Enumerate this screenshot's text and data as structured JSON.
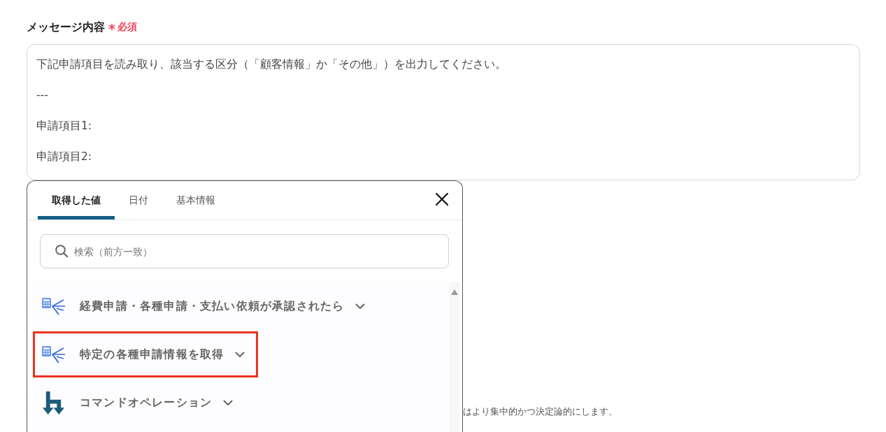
{
  "field": {
    "label": "メッセージ内容",
    "required_mark": "*",
    "required_label": "必須"
  },
  "message": {
    "lines": [
      "下記申請項目を読み取り、該当する区分（「顧客情報」か「その他」）を出力してください。",
      "---",
      "申請項目1:",
      "申請項目2:"
    ]
  },
  "help_text": "はより集中的かつ決定論的にします。",
  "picker": {
    "tabs": [
      {
        "label": "取得した値",
        "selected": true
      },
      {
        "label": "日付",
        "selected": false
      },
      {
        "label": "基本情報",
        "selected": false
      }
    ],
    "search": {
      "placeholder": "検索（前方一致）"
    },
    "items": [
      {
        "kind": "app",
        "label": "経費申請・各種申請・支払い依頼が承認されたら",
        "highlighted": false
      },
      {
        "kind": "app",
        "label": "特定の各種申請情報を取得",
        "highlighted": true
      },
      {
        "kind": "operation",
        "label": "コマンドオペレーション",
        "highlighted": false
      }
    ]
  }
}
